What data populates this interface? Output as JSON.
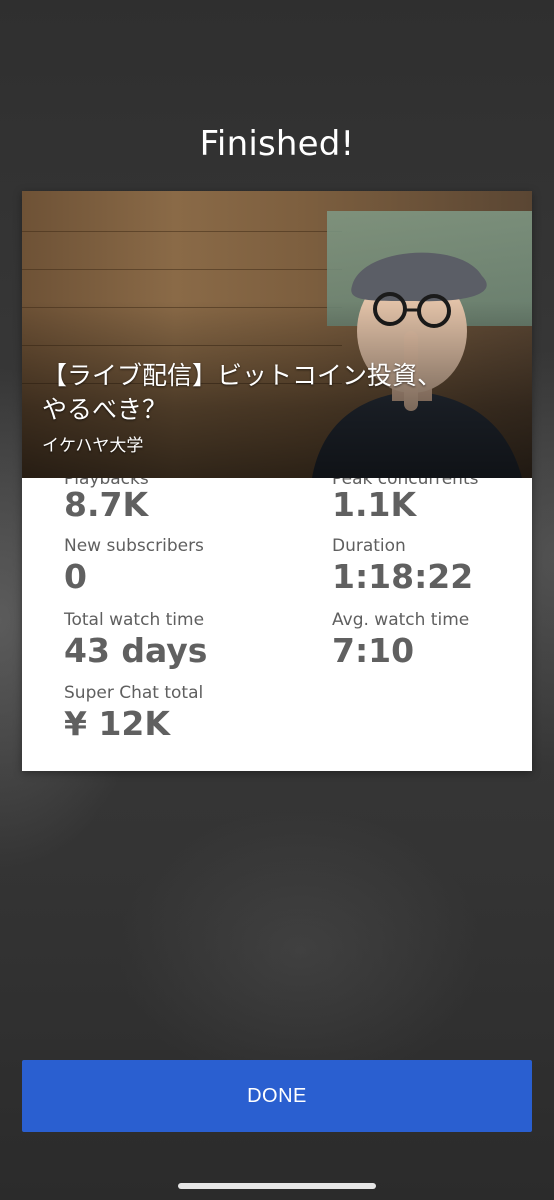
{
  "header": {
    "title": "Finished!"
  },
  "video": {
    "title": "【ライブ配信】ビットコイン投資、やるべき？",
    "channel": "イケハヤ大学"
  },
  "stats": {
    "playbacks": {
      "label": "Playbacks",
      "value": "8.7K"
    },
    "peak_concurrents": {
      "label": "Peak concurrents",
      "value": "1.1K"
    },
    "new_subscribers": {
      "label": "New subscribers",
      "value": "0"
    },
    "duration": {
      "label": "Duration",
      "value": "1:18:22"
    },
    "total_watch_time": {
      "label": "Total watch time",
      "value": "43 days"
    },
    "avg_watch_time": {
      "label": "Avg. watch time",
      "value": "7:10"
    },
    "super_chat_total": {
      "label": "Super Chat total",
      "value": "¥ 12K"
    }
  },
  "actions": {
    "done_label": "DONE"
  },
  "colors": {
    "accent": "#2a5fd0",
    "stat_text": "#606060",
    "background": "#353535"
  }
}
